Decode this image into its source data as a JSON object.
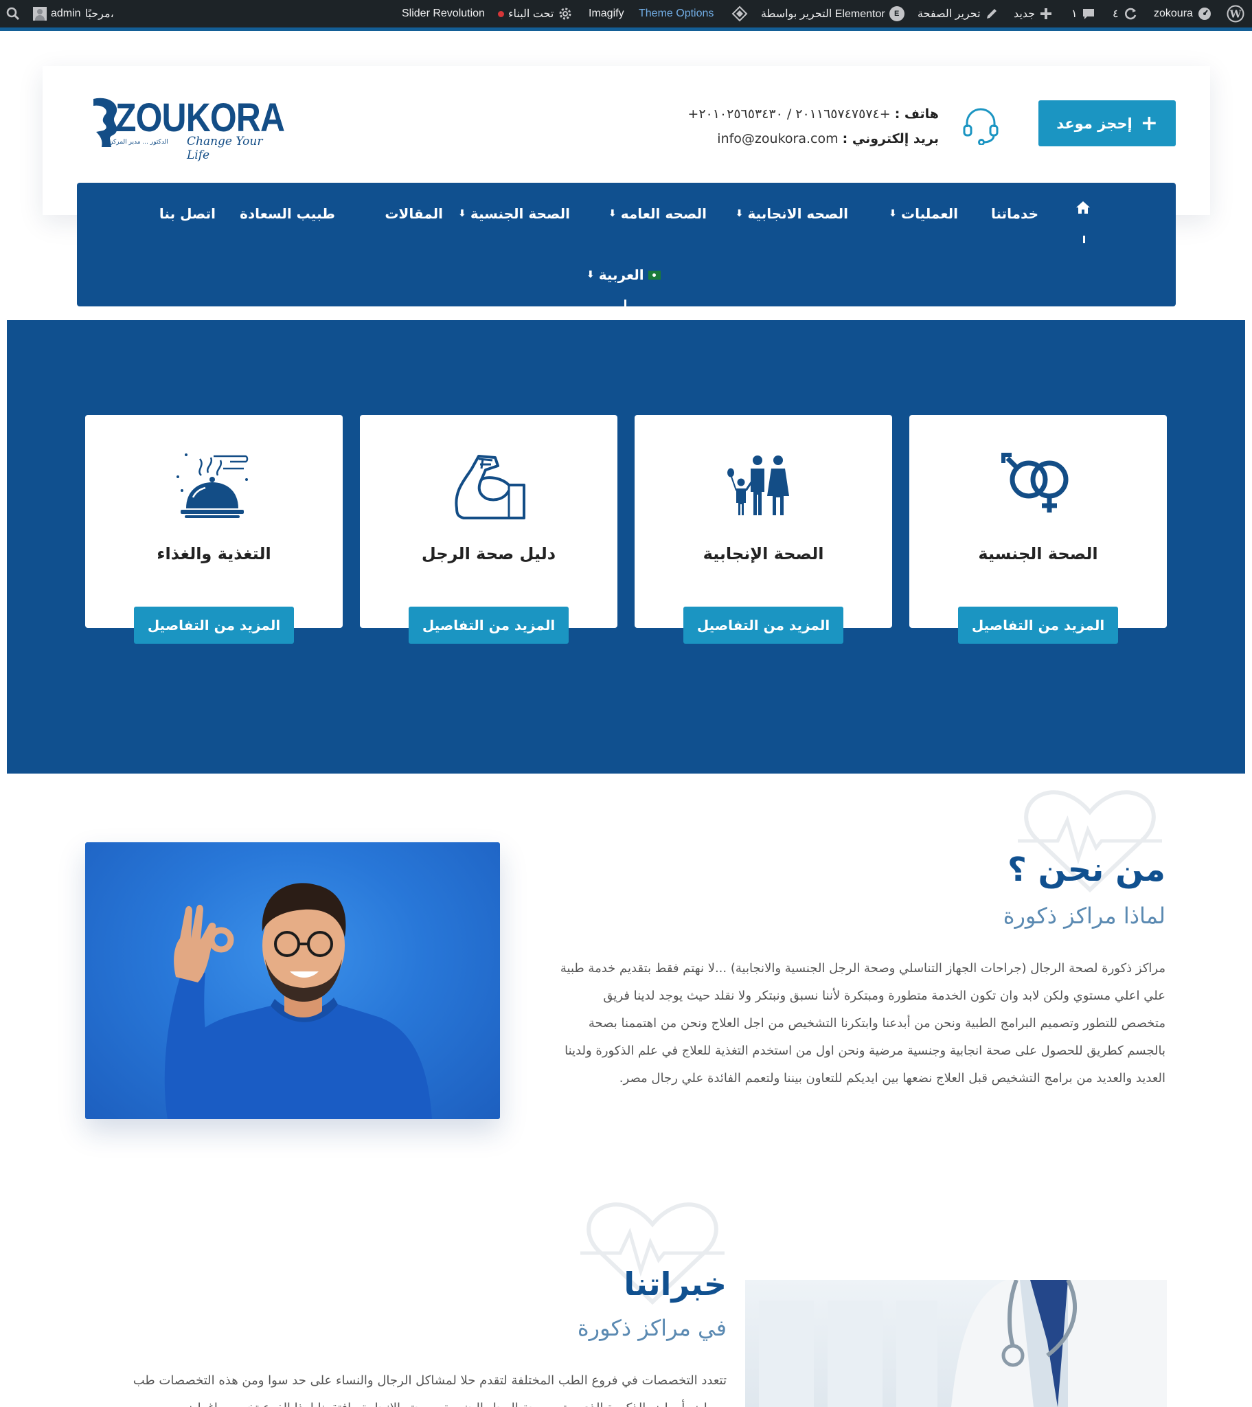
{
  "admin_bar": {
    "howdy": "مرحبًا،",
    "user": "admin",
    "slider_revolution": "Slider Revolution",
    "under_construction": "تحت البناء",
    "imagify": "Imagify",
    "theme_options": "Theme Options",
    "elementor_edit": "التحرير بواسطة Elementor",
    "edit_page": "تحرير الصفحة",
    "new": "جديد",
    "comments_count": "١",
    "updates_count": "٤",
    "site_name": "zokoura"
  },
  "header": {
    "logo_text": "ZOUKORA",
    "logo_tagline": "Change Your Life",
    "logo_sub": "الدكتور ... مدير المركز",
    "book_button": "إحجز موعد",
    "phone_label": "هاتف :",
    "phone_value": "+٢٠١١٦٥٧٤٧٥٧٤ / ٢٠١٠٢٥٦٥٣٤٣٠+",
    "email_label": "بريد إلكتروني :",
    "email_value": "info@zoukora.com"
  },
  "nav": {
    "items": [
      {
        "label": "خدماتنا"
      },
      {
        "label": "العمليات"
      },
      {
        "label": "الصحه الانجابية"
      },
      {
        "label": "الصحه العامه"
      },
      {
        "label": "الصحة الجنسية"
      },
      {
        "label": "المقالات"
      },
      {
        "label": "طبيب السعادة"
      },
      {
        "label": "اتصل بنا"
      }
    ],
    "language": "العربية"
  },
  "services": {
    "more_button": "المزيد من التفاصيل",
    "cards": [
      {
        "title": "الصحة الجنسية",
        "icon": "gender-symbols-icon"
      },
      {
        "title": "الصحة الإنجابية",
        "icon": "family-icon"
      },
      {
        "title": "دليل صحة الرجل",
        "icon": "flexed-arm-icon"
      },
      {
        "title": "التغذية والغذاء",
        "icon": "food-tray-icon"
      }
    ]
  },
  "about": {
    "title": "من نحن ؟",
    "subtitle": "لماذا مراكز ذكورة",
    "lines": [
      "مراكز ذكورة لصحة الرجال (جراحات الجهاز التناسلي وصحة الرجل الجنسية والانجابية) ...لا نهتم فقط بتقديم خدمة طبية",
      "علي اعلي مستوي ولكن لابد وان تكون الخدمة متطورة ومبتكرة لأننا نسبق ونبتكر ولا نقلد حيث يوجد لدينا فريق",
      "متخصص للتطور وتصميم البرامج الطبية ونحن من أبدعنا وابتكرنا التشخيص من اجل العلاج ونحن من اهتممنا بصحة",
      "بالجسم كطريق للحصول على صحة انجابية وجنسية مرضية ونحن اول من استخدم التغذية للعلاج في علم الذكورة ولدينا",
      "العديد والعديد من برامج التشخيص قبل العلاج نضعها بين ايديكم للتعاون بيننا ولتعمم الفائدة علي رجال مصر."
    ]
  },
  "experience": {
    "title": "خبراتنا",
    "subtitle": "في مراكز ذكورة",
    "lines": [
      "تتعدد التخصصات في فروع الطب المختلفة لتقدم حلا لمشاكل الرجال والنساء على حد سوا ومن هذه التخصصات طب",
      "ومراض أمراض الذكورة الذي يهتم بصحة الرجل الجنسية وصحته الانجابية وافتقرنا لهذا الفرع تخصص اغراض ..."
    ]
  },
  "colors": {
    "admin_bg": "#1d2327",
    "brand_blue": "#10508f",
    "accent_cyan": "#1b95c2"
  }
}
